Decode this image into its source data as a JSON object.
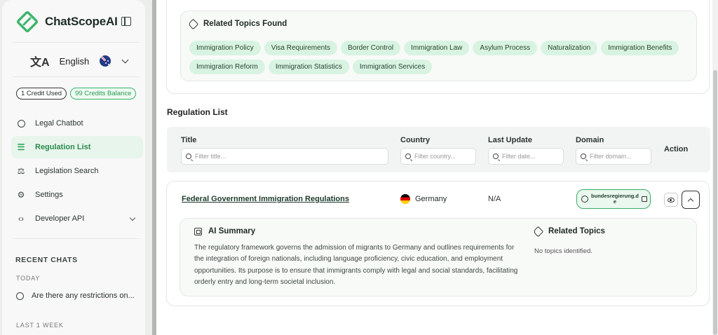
{
  "app": {
    "name": "ChatScopeAI"
  },
  "language": {
    "selected": "English"
  },
  "credits": {
    "used": "1 Credit Used",
    "balance": "99 Credits Balance"
  },
  "nav": [
    {
      "label": "Legal Chatbot",
      "icon": "chat-bubble-icon"
    },
    {
      "label": "Regulation List",
      "icon": "list-icon",
      "active": true
    },
    {
      "label": "Legislation Search",
      "icon": "scales-icon"
    },
    {
      "label": "Settings",
      "icon": "gear-icon"
    },
    {
      "label": "Developer API",
      "icon": "code-icon",
      "expandable": true
    }
  ],
  "recent": {
    "title": "RECENT CHATS",
    "today_label": "TODAY",
    "today_items": [
      "Are there any restrictions on..."
    ],
    "last_week_label": "LAST 1 WEEK"
  },
  "related_found": {
    "title": "Related Topics Found",
    "topics": [
      "Immigration Policy",
      "Visa Requirements",
      "Border Control",
      "Immigration Law",
      "Asylum Process",
      "Naturalization",
      "Immigration Benefits",
      "Immigration Reform",
      "Immigration Statistics",
      "Immigration Services"
    ]
  },
  "regulation_list": {
    "title": "Regulation List",
    "columns": {
      "title": {
        "label": "Title",
        "placeholder": "Filter title..."
      },
      "country": {
        "label": "Country",
        "placeholder": "Filter country..."
      },
      "last_update": {
        "label": "Last Update",
        "placeholder": "Filter date..."
      },
      "domain": {
        "label": "Domain",
        "placeholder": "Filter domain..."
      },
      "action": {
        "label": "Action"
      }
    },
    "rows": [
      {
        "title": "Federal Government Immigration Regulations",
        "country": "Germany",
        "last_update": "N/A",
        "domain": "bundesregierung.de",
        "ai_summary": {
          "title": "AI Summary",
          "text": "The regulatory framework governs the admission of migrants to Germany and outlines requirements for the integration of foreign nationals, including language proficiency, civic education, and employment opportunities. Its purpose is to ensure that immigrants comply with legal and social standards, facilitating orderly entry and long-term societal inclusion."
        },
        "related_topics": {
          "title": "Related Topics",
          "empty_text": "No topics identified."
        }
      }
    ]
  },
  "colors": {
    "accent": "#2fa35b",
    "chip_bg": "#d9f3e2"
  }
}
